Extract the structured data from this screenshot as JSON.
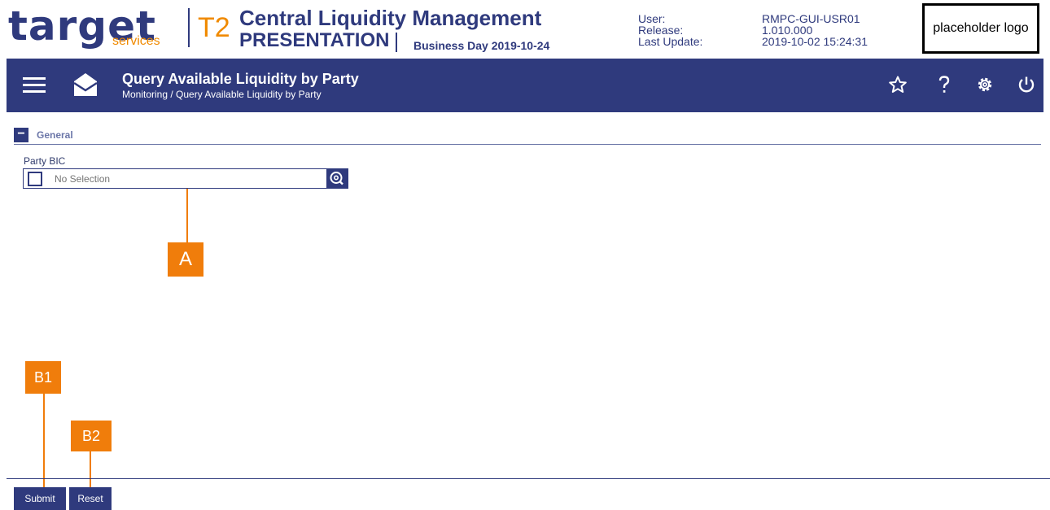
{
  "header": {
    "logo_word": "target",
    "logo_sub": "services",
    "product_code": "T2",
    "app_title": "Central Liquidity Management",
    "environment": "PRESENTATION",
    "business_day": "Business Day 2019-10-24",
    "meta": {
      "user_label": "User:",
      "user_value": "RMPC-GUI-USR01",
      "release_label": "Release:",
      "release_value": "1.010.000",
      "last_update_label": "Last Update:",
      "last_update_value": "2019-10-02 15:24:31"
    },
    "placeholder_logo": "placeholder logo"
  },
  "titlebar": {
    "page_title": "Query Available Liquidity by Party",
    "breadcrumb": "Monitoring  /  Query Available Liquidity by Party",
    "icons": [
      "menu-icon",
      "envelope-icon",
      "star-icon",
      "help-icon",
      "settings-icon",
      "power-icon"
    ]
  },
  "form": {
    "section_title": "General",
    "collapse_symbol": "−",
    "field_label": "Party BIC",
    "field_placeholder": "No Selection",
    "field_value": ""
  },
  "annotations": {
    "a": "A",
    "b1": "B1",
    "b2": "B2"
  },
  "footer": {
    "submit_label": "Submit",
    "reset_label": "Reset"
  },
  "colors": {
    "primary": "#2f3a7d",
    "accent": "#f08a00",
    "annotation": "#f07d0b"
  }
}
